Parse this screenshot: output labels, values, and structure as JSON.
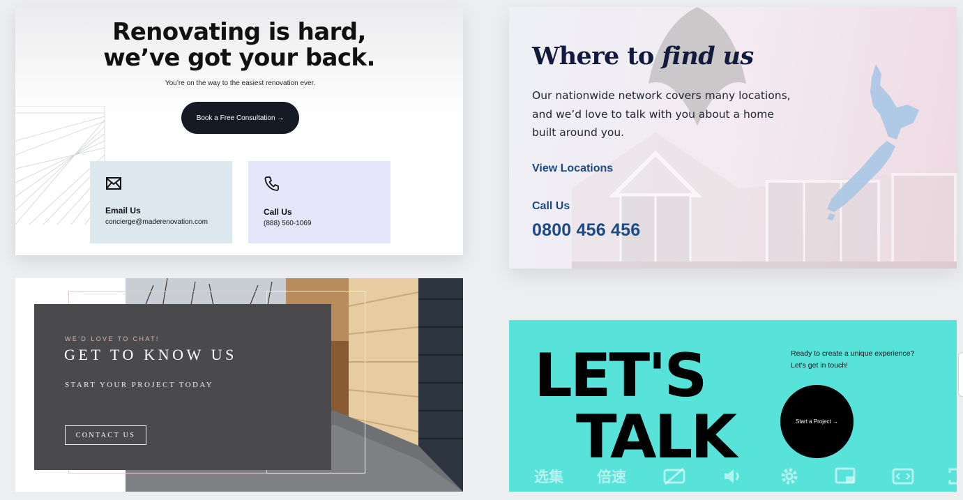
{
  "card1": {
    "headline_line1": "Renovating is hard,",
    "headline_line2": "we’ve got your back.",
    "subtitle": "You’re on the way to the easiest renovation ever.",
    "cta": "Book a Free Consultation →",
    "email": {
      "icon": "envelope-icon",
      "title": "Email Us",
      "value": "concierge@maderenovation.com"
    },
    "call": {
      "icon": "phone-icon",
      "title": "Call Us",
      "value": "(888) 560-1069"
    }
  },
  "card2": {
    "title_plain": "Where to ",
    "title_italic": "find us",
    "body": "Our nationwide network covers many locations, and we’d love to talk with you about a home built around you.",
    "link": "View Locations",
    "call_label": "Call Us",
    "phone": "0800 456 456",
    "map_icon": "new-zealand-map-icon"
  },
  "card3": {
    "kicker": "WE'D LOVE TO CHAT!",
    "title": "GET TO KNOW US",
    "subtitle": "START YOUR PROJECT TODAY",
    "button": "CONTACT US"
  },
  "card4": {
    "big_line1": "LET'S",
    "big_line2": "TALK",
    "tagline_line1": "Ready to create a unique experience?",
    "tagline_line2": "Let's get in touch!",
    "cta": "Start a Project →"
  },
  "player": {
    "episodes_label": "选集",
    "speed_label": "倍速",
    "icons": [
      "subtitles-off-icon",
      "volume-icon",
      "settings-gear-icon",
      "picture-in-picture-icon",
      "widescreen-icon",
      "fullscreen-icon"
    ]
  },
  "colors": {
    "navy_button": "#151a24",
    "email_bg": "#dce7ee",
    "call_bg": "#e6e6fa",
    "blue_link": "#1b4a85",
    "panel_grey": "#4a4a4c",
    "teal": "#57e2da"
  }
}
